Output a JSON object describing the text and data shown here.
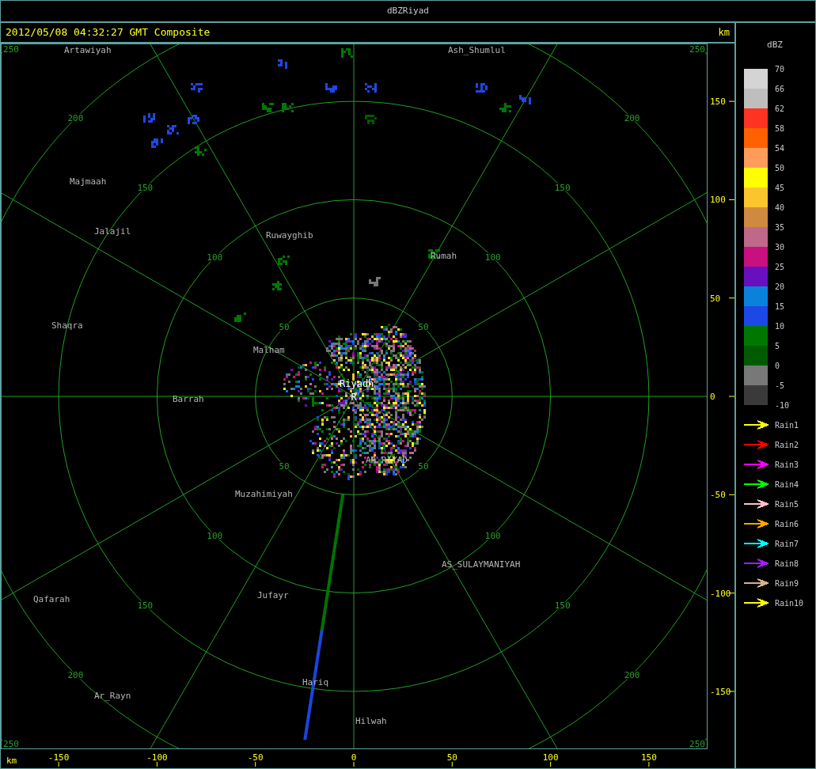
{
  "window": {
    "title": "dBZRiyad"
  },
  "header": {
    "timestamp": "2012/05/08 04:32:27 GMT Composite",
    "unit": "km"
  },
  "plot": {
    "ring_labels": [
      "50",
      "50",
      "50",
      "50",
      "100",
      "100",
      "100",
      "100",
      "150",
      "150",
      "150",
      "150",
      "200",
      "200",
      "200",
      "200",
      "250",
      "250",
      "250",
      "250"
    ],
    "cities": [
      {
        "name": "Artawiyah",
        "kind": "town"
      },
      {
        "name": "Ash_Shumlul",
        "kind": "town"
      },
      {
        "name": "Majmaah",
        "kind": "town"
      },
      {
        "name": "Jalajil",
        "kind": "town"
      },
      {
        "name": "Ruwayghib",
        "kind": "town"
      },
      {
        "name": "Rumah",
        "kind": "town"
      },
      {
        "name": "Shaqra",
        "kind": "town"
      },
      {
        "name": "Malham",
        "kind": "town"
      },
      {
        "name": "Riyadh",
        "kind": "site"
      },
      {
        "name": "Barrah",
        "kind": "town"
      },
      {
        "name": "AR_RIYAD",
        "kind": "town"
      },
      {
        "name": "Muzahimiyah",
        "kind": "town"
      },
      {
        "name": "AS_SULAYMANIYAH",
        "kind": "town"
      },
      {
        "name": "Qafarah",
        "kind": "town"
      },
      {
        "name": "Jufayr",
        "kind": "town"
      },
      {
        "name": "Hariq",
        "kind": "town"
      },
      {
        "name": "Ar_Rayn",
        "kind": "town"
      },
      {
        "name": "Hilwah",
        "kind": "town"
      }
    ],
    "site_marker": "R",
    "x_axis": {
      "unit": "km",
      "ticks": [
        "-150",
        "-100",
        "-50",
        "0",
        "50",
        "100",
        "150"
      ]
    },
    "y_axis": {
      "ticks": [
        "150",
        "100",
        "50",
        "0",
        "-50",
        "-100",
        "-150"
      ]
    }
  },
  "legend": {
    "title": "dBZ",
    "scale_labels": [
      "70",
      "66",
      "62",
      "58",
      "54",
      "50",
      "45",
      "40",
      "35",
      "30",
      "25",
      "20",
      "15",
      "10",
      "5",
      "0",
      "-5",
      "-10"
    ],
    "bins": [
      {
        "color": "#d4d4d4"
      },
      {
        "color": "#bebebe"
      },
      {
        "color": "#ff3322"
      },
      {
        "color": "#ff6000"
      },
      {
        "color": "#ff9c5a"
      },
      {
        "color": "#ffff00"
      },
      {
        "color": "#fcc530"
      },
      {
        "color": "#d08a40"
      },
      {
        "color": "#c0688a"
      },
      {
        "color": "#c81080"
      },
      {
        "color": "#6810c0"
      },
      {
        "color": "#0a82dc"
      },
      {
        "color": "#1c48e8"
      },
      {
        "color": "#007800"
      },
      {
        "color": "#005a00"
      },
      {
        "color": "#787878"
      },
      {
        "color": "#3a3a3a"
      }
    ],
    "tracks": [
      {
        "label": "Rain1",
        "color": "#ffff00"
      },
      {
        "label": "Rain2",
        "color": "#ff0000"
      },
      {
        "label": "Rain3",
        "color": "#ff00ff"
      },
      {
        "label": "Rain4",
        "color": "#00ff00"
      },
      {
        "label": "Rain5",
        "color": "#ffc0cb"
      },
      {
        "label": "Rain6",
        "color": "#ffa500"
      },
      {
        "label": "Rain7",
        "color": "#00ffff"
      },
      {
        "label": "Rain8",
        "color": "#a020f0"
      },
      {
        "label": "Rain9",
        "color": "#d2b48c"
      },
      {
        "label": "Rain10",
        "color": "#ffff00"
      }
    ]
  }
}
